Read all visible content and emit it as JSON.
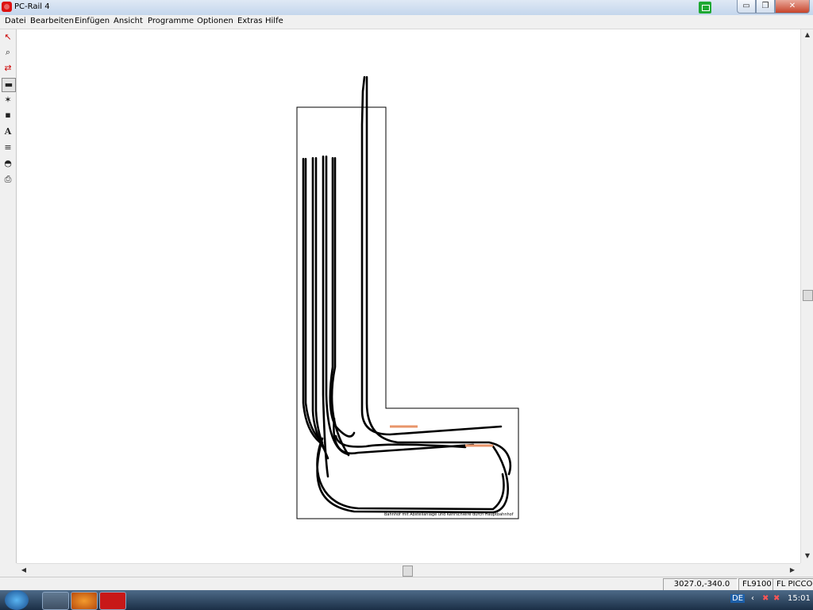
{
  "window": {
    "title": "PC-Rail 4",
    "controls": {
      "minimize": "▭",
      "restore": "❐",
      "close": "✕"
    }
  },
  "menu": [
    "Datei",
    "Bearbeiten",
    "Einfügen",
    "Ansicht",
    "Programme",
    "Optionen",
    "Extras",
    "Hilfe"
  ],
  "tools": [
    {
      "icon": "select-arrow-icon",
      "glyph": "↖"
    },
    {
      "icon": "zoom-icon",
      "glyph": "⌕"
    },
    {
      "icon": "swap-icon",
      "glyph": "⇄"
    },
    {
      "icon": "track-icon",
      "glyph": "▬"
    },
    {
      "icon": "crossing-icon",
      "glyph": "✶"
    },
    {
      "icon": "signal-icon",
      "glyph": "▪"
    },
    {
      "icon": "text-icon",
      "glyph": "A"
    },
    {
      "icon": "layers-icon",
      "glyph": "≡"
    },
    {
      "icon": "roof-icon",
      "glyph": "◓"
    },
    {
      "icon": "print-icon",
      "glyph": "⎙"
    }
  ],
  "drawing": {
    "caption": "Bahnhof mit Abstellanlage und Kehrschleife durch Hauptbahnhof"
  },
  "status": {
    "coords": "3027.0,-340.0",
    "item": "FL9100",
    "series": "FL PICCOLO"
  },
  "taskbar": {
    "lang": "DE",
    "time": "15:01"
  },
  "colors": {
    "track": "#000000",
    "accent": "#e8956a",
    "title": "#c4d6ec"
  }
}
